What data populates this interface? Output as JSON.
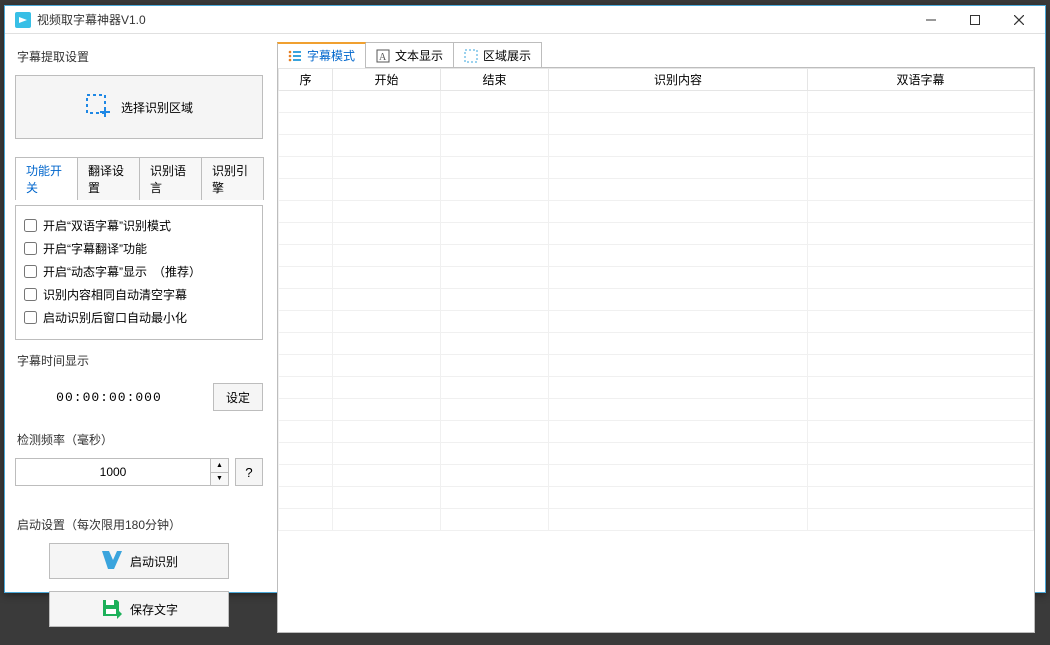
{
  "titlebar": {
    "title": "视频取字幕神器V1.0"
  },
  "left": {
    "section_extract": "字幕提取设置",
    "select_region_label": "选择识别区域",
    "tabs": {
      "func_switch": "功能开关",
      "translate_settings": "翻译设置",
      "lang": "识别语言",
      "engine": "识别引擎"
    },
    "checks": {
      "bilingual_mode": "开启“双语字幕”识别模式",
      "translate_func": "开启“字幕翻译”功能",
      "dynamic_sub": "开启“动态字幕”显示　（推荐）",
      "auto_clear": "识别内容相同自动清空字幕",
      "auto_minimize": "启动识别后窗口自动最小化"
    },
    "section_time": "字幕时间显示",
    "time_value": "00:00:00:000",
    "set_btn": "设定",
    "section_frequency": "检测频率（毫秒）",
    "frequency_value": "1000",
    "help_label": "?",
    "section_start": "启动设置（每次限用180分钟）",
    "start_recognize": "启动识别",
    "save_text": "保存文字"
  },
  "right": {
    "tabs": {
      "subtitle_mode": "字幕模式",
      "text_display": "文本显示",
      "region_show": "区域展示"
    },
    "columns": {
      "seq": "序",
      "start": "开始",
      "end": "结束",
      "content": "识别内容",
      "bilingual": "双语字幕"
    }
  }
}
